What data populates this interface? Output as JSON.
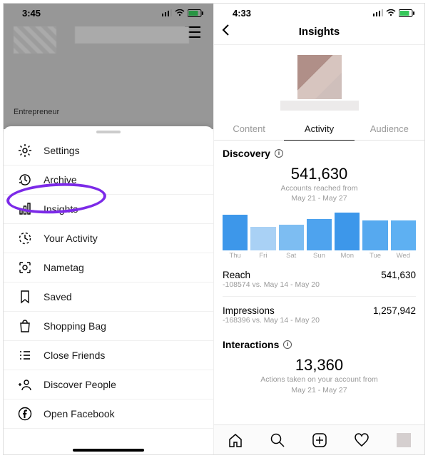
{
  "left": {
    "status_time": "3:45",
    "bio_label": "Entrepreneur",
    "menu": [
      {
        "icon": "gear-icon",
        "label": "Settings"
      },
      {
        "icon": "clock-history-icon",
        "label": "Archive"
      },
      {
        "icon": "bar-chart-icon",
        "label": "Insights"
      },
      {
        "icon": "clock-partial-icon",
        "label": "Your Activity"
      },
      {
        "icon": "nametag-icon",
        "label": "Nametag"
      },
      {
        "icon": "bookmark-icon",
        "label": "Saved"
      },
      {
        "icon": "shopping-bag-icon",
        "label": "Shopping Bag"
      },
      {
        "icon": "list-icon",
        "label": "Close Friends"
      },
      {
        "icon": "add-person-icon",
        "label": "Discover People"
      },
      {
        "icon": "facebook-icon",
        "label": "Open Facebook"
      }
    ]
  },
  "right": {
    "status_time": "4:33",
    "page_title": "Insights",
    "tabs": {
      "content": "Content",
      "activity": "Activity",
      "audience": "Audience",
      "active": "activity"
    },
    "discovery": {
      "title": "Discovery",
      "total": "541,630",
      "sub1": "Accounts reached from",
      "sub2": "May 21 - May 27"
    },
    "reach": {
      "label": "Reach",
      "value": "541,630",
      "delta": "-108574 vs. May 14 - May 20"
    },
    "impressions": {
      "label": "Impressions",
      "value": "1,257,942",
      "delta": "-168396 vs. May 14 - May 20"
    },
    "interactions": {
      "title": "Interactions",
      "total": "13,360",
      "sub1": "Actions taken on your account from",
      "sub2": "May 21 - May 27"
    }
  },
  "chart_data": {
    "type": "bar",
    "title": "Accounts reached per day",
    "categories": [
      "Thu",
      "Fri",
      "Sat",
      "Sun",
      "Mon",
      "Tue",
      "Wed"
    ],
    "values": [
      90000,
      60000,
      65000,
      80000,
      95000,
      76000,
      76000
    ],
    "colors": [
      "#3d97ea",
      "#a9d1f5",
      "#7dbdf2",
      "#4ea3ee",
      "#3d97ea",
      "#56a9ef",
      "#5eb0f2"
    ],
    "ylim": [
      0,
      100000
    ],
    "total": 541630,
    "range": "May 21 - May 27"
  }
}
